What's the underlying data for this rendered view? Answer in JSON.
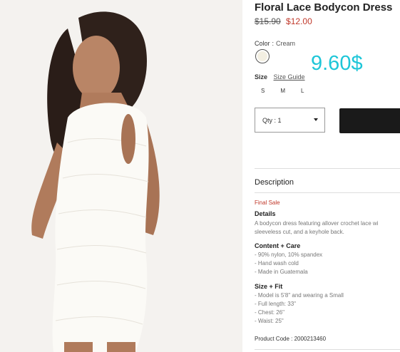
{
  "product": {
    "title": "Floral Lace Bodycon Dress",
    "old_price": "$15.90",
    "sale_price": "$12.00",
    "overlay_price": "9.60$",
    "color_label": "Color",
    "color_sep": ":",
    "color_value": "Cream",
    "swatch_color": "#f3efe2",
    "size_label": "Size",
    "size_guide": "Size Guide",
    "sizes": [
      "S",
      "M",
      "L"
    ],
    "qty_label": "Qty : 1",
    "description_heading": "Description",
    "final_sale": "Final Sale",
    "details_heading": "Details",
    "details_lines": [
      "A bodycon dress featuring allover crochet lace wi",
      "sleeveless cut, and a keyhole back."
    ],
    "content_heading": "Content + Care",
    "content_lines": [
      "- 90% nylon, 10% spandex",
      "- Hand wash cold",
      "- Made in Guatemala"
    ],
    "fit_heading": "Size + Fit",
    "fit_lines": [
      "- Model is 5'8\" and wearing a Small",
      "- Full length: 33\"",
      "- Chest: 26\"",
      "- Waist: 25\""
    ],
    "product_code": "Product Code : 2000213460"
  },
  "colors": {
    "sale_red": "#c0392b",
    "overlay_cyan": "#1ec6d8",
    "button_dark": "#1a1a1a"
  }
}
